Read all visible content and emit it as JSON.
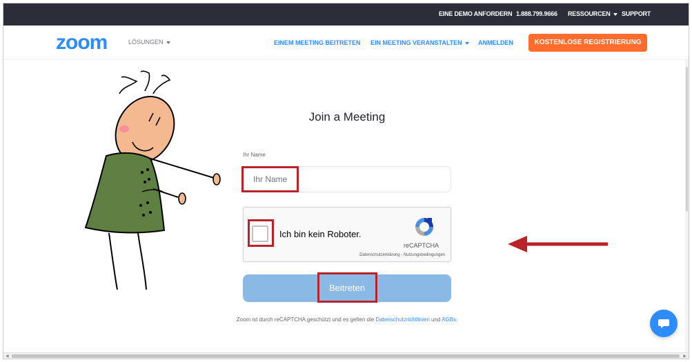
{
  "topbar": {
    "demo_label": "EINE DEMO ANFORDERN",
    "phone": "1.888.799.9666",
    "resources_label": "RESSOURCEN",
    "support_label": "SUPPORT"
  },
  "nav": {
    "logo_text": "zoom",
    "solutions_label": "LÖSUNGEN",
    "join_meeting_label": "EINEM MEETING BEITRETEN",
    "host_meeting_label": "EIN MEETING VERANSTALTEN",
    "signin_label": "ANMELDEN",
    "signup_label": "KOSTENLOSE REGISTRIERUNG"
  },
  "form": {
    "title": "Join a Meeting",
    "name_label": "Ihr Name",
    "name_placeholder": "Ihr Name",
    "name_value": "",
    "captcha_text": "Ich bin kein Roboter.",
    "captcha_brand": "reCAPTCHA",
    "captcha_privacy": "Datenschutzerklärung",
    "captcha_sep": " - ",
    "captcha_terms": "Nutzungsbedingungen",
    "join_label": "Beitreten"
  },
  "footer": {
    "recaptcha_note": "Zoom ist durch reCAPTCHA geschützt und es gelten die ",
    "privacy_link": "Datenschutzrichtlinien",
    "and_text": " und ",
    "terms_link": "AGBs",
    "period": "."
  },
  "colors": {
    "topbar_bg": "#2d2d3a",
    "brand_blue": "#2d8cff",
    "signup_orange": "#ff6c2b",
    "join_button": "#8ab9e6",
    "highlight_red": "#b8232a"
  },
  "icons": {
    "chat": "chat-bubble-icon",
    "recaptcha": "recaptcha-logo-icon",
    "arrow": "left-arrow-annotation"
  }
}
